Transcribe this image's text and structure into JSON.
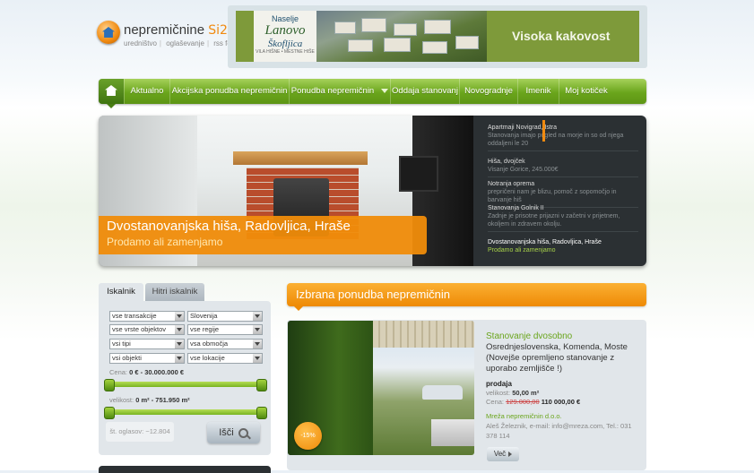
{
  "logo": {
    "name": "nepremičnine",
    "brand": "Si21",
    "links": [
      "uredništvo",
      "oglaševanje",
      "rss feed"
    ]
  },
  "banner": {
    "line1": "Naselje",
    "line2": "Lanovo",
    "line3": "Škofljica",
    "small": "VILA HIŠNE • MESTNE HIŠE",
    "tagline": "Visoka kakovost"
  },
  "nav": {
    "items": [
      "Aktualno",
      "Akcijska ponudba nepremičnin",
      "Ponudba nepremičnin",
      "Oddaja stanovanj",
      "Novogradnje",
      "Imenik",
      "Moj kotiček"
    ]
  },
  "slider": {
    "caption_title": "Dvostanovanjska hiša, Radovljica, Hraše",
    "caption_sub": "Prodamo ali zamenjamo",
    "list": [
      {
        "title": "Apartmaji Novigrad, Istra",
        "desc": "Stanovanja imajo pogled na morje in so od njega oddaljeni le 20"
      },
      {
        "title": "Hiša, dvojček",
        "desc": "Visanje Gorice, 245.000€"
      },
      {
        "title": "Notranja oprema",
        "desc": "prepričeni nam je blizu, pomoč z sopomočjo in barvanje hiš"
      },
      {
        "title": "Stanovanja Golnik II",
        "desc": "Zadnje je prisotne prijazni v začetni v prijetnem, okoljem in zdravem okolju."
      },
      {
        "title": "Dvostanovanjska hiša, Radovljica, Hraše",
        "desc": "Prodamo ali zamenjamo"
      }
    ]
  },
  "search": {
    "tab_active": "Iskalnik",
    "tab_inactive": "Hitri iskalnik",
    "selects": [
      "vse transakcije",
      "Slovenija",
      "vse vrste objektov",
      "vse regije",
      "vsi tipi",
      "vsa območja",
      "vsi objekti",
      "vse lokacije"
    ],
    "price_label": "Cena:",
    "price_value": "0 € - 30.000.000 €",
    "size_label": "velikost:",
    "size_value": "0 m² - 751.950 m²",
    "count": "št. oglasov: ~12.804",
    "button": "Išči"
  },
  "featured": {
    "header": "Izbrana ponudba nepremičnin",
    "badge": "-15%",
    "title": "Stanovanje dvosobno",
    "location": "Osrednjeslovenska, Komenda, Moste",
    "desc": "(Novejše opremljeno stanovanje z uporabo zemljišče !)",
    "type": "prodaja",
    "size_label": "velikost:",
    "size_value": "50,00 m²",
    "price_label": "Cena:",
    "old_price": "129.000,00",
    "new_price": "110 000,00 €",
    "agency": "Mreža nepremičnin d.o.o.",
    "contact": "Aleš Železnik, e-mail: info@mreza.com, Tel.: 031 378 114",
    "more": "Več"
  },
  "colors": {
    "accent_green": "#6aa51c",
    "accent_orange": "#f08a10",
    "dark": "#2b3033"
  }
}
